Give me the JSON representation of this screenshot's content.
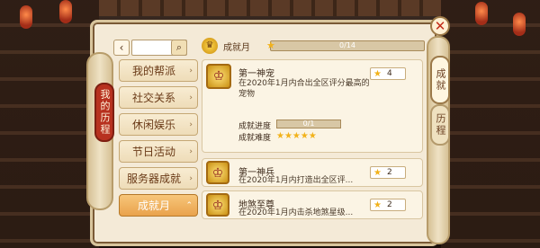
{
  "window": {
    "close_icon": "✕"
  },
  "left_tab": "我的历程",
  "right_tabs": [
    {
      "label": "成就"
    },
    {
      "label": "历程"
    }
  ],
  "search": {
    "placeholder": "",
    "back_glyph": "‹"
  },
  "menu": [
    {
      "label": "我的帮派",
      "chevron": "›",
      "active": false
    },
    {
      "label": "社交关系",
      "chevron": "›",
      "active": false
    },
    {
      "label": "休闲娱乐",
      "chevron": "›",
      "active": false
    },
    {
      "label": "节日活动",
      "chevron": "›",
      "active": false
    },
    {
      "label": "服务器成就",
      "chevron": "›",
      "active": false
    },
    {
      "label": "成就月",
      "chevron": "⌃",
      "active": true
    }
  ],
  "category": {
    "label": "成就月",
    "progress_text": "0/14",
    "progress_value": 0
  },
  "achievements": [
    {
      "title": "第一神宠",
      "desc": "在2020年1月内合出全区评分最高的宠物",
      "points": "4",
      "detail": {
        "progress_label": "成就进度",
        "progress_text": "0/1",
        "progress_value": 0,
        "difficulty_label": "成就难度",
        "difficulty_stars": "★★★★★"
      }
    },
    {
      "title": "第一神兵",
      "desc": "在2020年1月内打造出全区评...",
      "points": "2"
    },
    {
      "title": "地煞至尊",
      "desc": "在2020年1月内击杀地煞星级...",
      "points": "2"
    }
  ],
  "colors": {
    "accent": "#e9a24c",
    "tab_red": "#b7311f",
    "star": "#f2b21a"
  }
}
